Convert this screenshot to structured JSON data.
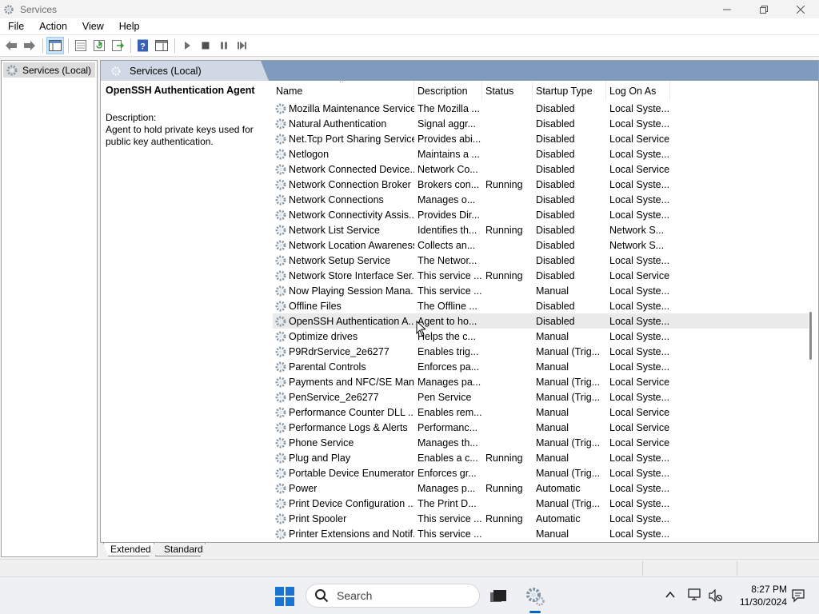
{
  "window": {
    "title": "Services",
    "controls": [
      "minimize",
      "maximize",
      "close"
    ]
  },
  "menu": {
    "items": [
      "File",
      "Action",
      "View",
      "Help"
    ]
  },
  "toolbar": {
    "buttons": [
      "back-icon",
      "forward-icon",
      "show-hide-console-tree-icon",
      "properties-icon",
      "refresh-icon",
      "export-list-icon",
      "help-icon",
      "show-hide-action-pane-icon",
      "start-service-icon",
      "stop-service-icon",
      "pause-service-icon",
      "restart-service-icon"
    ]
  },
  "tree": {
    "root_label": "Services (Local)"
  },
  "pane": {
    "header": "Services (Local)",
    "selected_title": "OpenSSH Authentication Agent",
    "description_label": "Description:",
    "description_text": "Agent to hold private keys used for public key authentication."
  },
  "columns": {
    "name": "Name",
    "description": "Description",
    "status": "Status",
    "startup_type": "Startup Type",
    "log_on_as": "Log On As"
  },
  "services": [
    {
      "name": "Mozilla Maintenance Service",
      "description": "The Mozilla ...",
      "status": "",
      "startup": "Disabled",
      "logon": "Local Syste..."
    },
    {
      "name": "Natural Authentication",
      "description": "Signal aggr...",
      "status": "",
      "startup": "Disabled",
      "logon": "Local Syste..."
    },
    {
      "name": "Net.Tcp Port Sharing Service",
      "description": "Provides abi...",
      "status": "",
      "startup": "Disabled",
      "logon": "Local Service"
    },
    {
      "name": "Netlogon",
      "description": "Maintains a ...",
      "status": "",
      "startup": "Disabled",
      "logon": "Local Syste..."
    },
    {
      "name": "Network Connected Device...",
      "description": "Network Co...",
      "status": "",
      "startup": "Disabled",
      "logon": "Local Service"
    },
    {
      "name": "Network Connection Broker",
      "description": "Brokers con...",
      "status": "Running",
      "startup": "Disabled",
      "logon": "Local Syste..."
    },
    {
      "name": "Network Connections",
      "description": "Manages o...",
      "status": "",
      "startup": "Disabled",
      "logon": "Local Syste..."
    },
    {
      "name": "Network Connectivity Assis...",
      "description": "Provides Dir...",
      "status": "",
      "startup": "Disabled",
      "logon": "Local Syste..."
    },
    {
      "name": "Network List Service",
      "description": "Identifies th...",
      "status": "Running",
      "startup": "Disabled",
      "logon": "Network S..."
    },
    {
      "name": "Network Location Awareness",
      "description": "Collects an...",
      "status": "",
      "startup": "Disabled",
      "logon": "Network S..."
    },
    {
      "name": "Network Setup Service",
      "description": "The Networ...",
      "status": "",
      "startup": "Disabled",
      "logon": "Local Syste..."
    },
    {
      "name": "Network Store Interface Ser...",
      "description": "This service ...",
      "status": "Running",
      "startup": "Disabled",
      "logon": "Local Service"
    },
    {
      "name": "Now Playing Session Mana...",
      "description": "This service ...",
      "status": "",
      "startup": "Manual",
      "logon": "Local Syste..."
    },
    {
      "name": "Offline Files",
      "description": "The Offline ...",
      "status": "",
      "startup": "Disabled",
      "logon": "Local Syste..."
    },
    {
      "name": "OpenSSH Authentication A...",
      "description": "Agent to ho...",
      "status": "",
      "startup": "Disabled",
      "logon": "Local Syste...",
      "highlighted": true
    },
    {
      "name": "Optimize drives",
      "description": "Helps the c...",
      "status": "",
      "startup": "Manual",
      "logon": "Local Syste..."
    },
    {
      "name": "P9RdrService_2e6277",
      "description": "Enables trig...",
      "status": "",
      "startup": "Manual (Trig...",
      "logon": "Local Syste..."
    },
    {
      "name": "Parental Controls",
      "description": "Enforces pa...",
      "status": "",
      "startup": "Manual",
      "logon": "Local Syste..."
    },
    {
      "name": "Payments and NFC/SE Man...",
      "description": "Manages pa...",
      "status": "",
      "startup": "Manual (Trig...",
      "logon": "Local Service"
    },
    {
      "name": "PenService_2e6277",
      "description": "Pen Service",
      "status": "",
      "startup": "Manual (Trig...",
      "logon": "Local Syste..."
    },
    {
      "name": "Performance Counter DLL ...",
      "description": "Enables rem...",
      "status": "",
      "startup": "Manual",
      "logon": "Local Service"
    },
    {
      "name": "Performance Logs & Alerts",
      "description": "Performanc...",
      "status": "",
      "startup": "Manual",
      "logon": "Local Service"
    },
    {
      "name": "Phone Service",
      "description": "Manages th...",
      "status": "",
      "startup": "Manual (Trig...",
      "logon": "Local Service"
    },
    {
      "name": "Plug and Play",
      "description": "Enables a c...",
      "status": "Running",
      "startup": "Manual",
      "logon": "Local Syste..."
    },
    {
      "name": "Portable Device Enumerator...",
      "description": "Enforces gr...",
      "status": "",
      "startup": "Manual (Trig...",
      "logon": "Local Syste..."
    },
    {
      "name": "Power",
      "description": "Manages p...",
      "status": "Running",
      "startup": "Automatic",
      "logon": "Local Syste..."
    },
    {
      "name": "Print Device Configuration ...",
      "description": "The Print D...",
      "status": "",
      "startup": "Manual (Trig...",
      "logon": "Local Syste..."
    },
    {
      "name": "Print Spooler",
      "description": "This service ...",
      "status": "Running",
      "startup": "Automatic",
      "logon": "Local Syste..."
    },
    {
      "name": "Printer Extensions and Notif...",
      "description": "This service ...",
      "status": "",
      "startup": "Manual",
      "logon": "Local Syste..."
    }
  ],
  "bottom_tabs": [
    "Extended",
    "Standard"
  ],
  "taskbar": {
    "search_placeholder": "Search",
    "time": "8:27 PM",
    "date": "11/30/2024"
  }
}
